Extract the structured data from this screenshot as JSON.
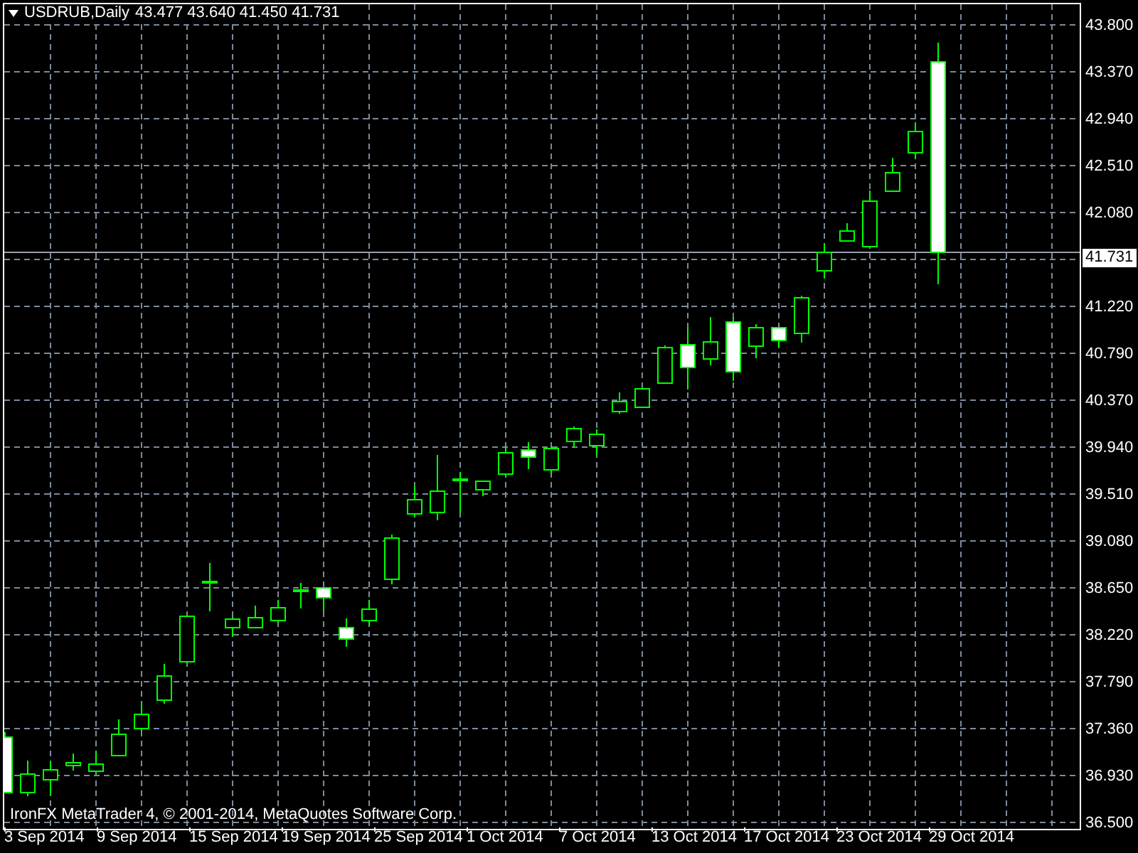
{
  "header": {
    "symbol": "USDRUB,Daily",
    "ohlc": "43.477 43.640 41.450 41.731"
  },
  "price_axis": [
    {
      "kind": "tick",
      "text": "43.800"
    },
    {
      "kind": "tick",
      "text": "43.370"
    },
    {
      "kind": "tick",
      "text": "42.940"
    },
    {
      "kind": "tick",
      "text": "42.510"
    },
    {
      "kind": "tick",
      "text": "42.080"
    },
    {
      "kind": "price_tag",
      "text": "41.731"
    },
    {
      "kind": "tick",
      "text": "41.220"
    },
    {
      "kind": "tick",
      "text": "40.790"
    },
    {
      "kind": "tick",
      "text": "40.370"
    },
    {
      "kind": "tick",
      "text": "39.940"
    },
    {
      "kind": "tick",
      "text": "39.510"
    },
    {
      "kind": "tick",
      "text": "39.080"
    },
    {
      "kind": "tick",
      "text": "38.650"
    },
    {
      "kind": "tick",
      "text": "38.220"
    },
    {
      "kind": "tick",
      "text": "37.790"
    },
    {
      "kind": "tick",
      "text": "37.360"
    },
    {
      "kind": "tick",
      "text": "36.930"
    },
    {
      "kind": "tick",
      "text": "36.500"
    }
  ],
  "time_axis": [
    "3 Sep 2014",
    "9 Sep 2014",
    "15 Sep 2014",
    "19 Sep 2014",
    "25 Sep 2014",
    "1 Oct 2014",
    "7 Oct 2014",
    "13 Oct 2014",
    "17 Oct 2014",
    "23 Oct 2014",
    "29 Oct 2014"
  ],
  "copyright": "IronFX MetaTrader 4, © 2001-2014, MetaQuotes Software Corp."
}
